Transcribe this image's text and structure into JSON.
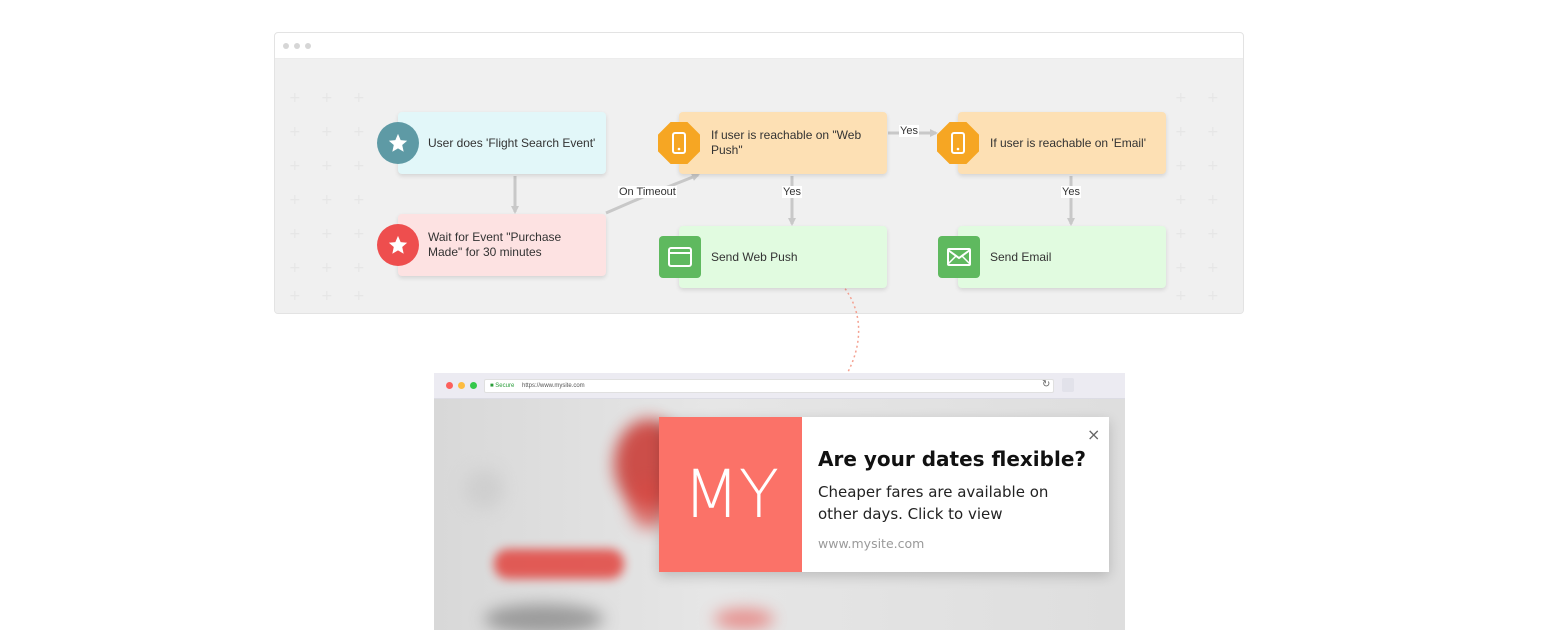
{
  "workflow": {
    "nodes": {
      "trigger": {
        "label": "User does 'Flight Search Event'",
        "icon": "star-icon"
      },
      "wait": {
        "label": "Wait for Event \"Purchase Made\" for 30 minutes",
        "icon": "star-icon"
      },
      "webpush_condition": {
        "label": "If user is reachable on \"Web Push\"",
        "icon": "mobile-icon"
      },
      "email_condition": {
        "label": "If user is reachable on 'Email'",
        "icon": "mobile-icon"
      },
      "send_webpush": {
        "label": "Send Web Push",
        "icon": "browser-window-icon"
      },
      "send_email": {
        "label": "Send Email",
        "icon": "envelope-icon"
      }
    },
    "edges": {
      "on_timeout": "On Timeout",
      "yes_webpush": "Yes",
      "yes_to_email": "Yes",
      "yes_email": "Yes"
    },
    "colors": {
      "teal": "#5e9aa5",
      "red": "#ee4e4e",
      "orange": "#f6a623",
      "green": "#5fb95f"
    }
  },
  "browser": {
    "secure_label": "Secure",
    "url": "https://www.mysite.com"
  },
  "notification": {
    "logo_text": "MY",
    "title": "Are your dates flexible?",
    "body": "Cheaper fares are available on other days. Click to view",
    "site": "www.mysite.com",
    "close": "×",
    "accent": "#fb7268"
  }
}
